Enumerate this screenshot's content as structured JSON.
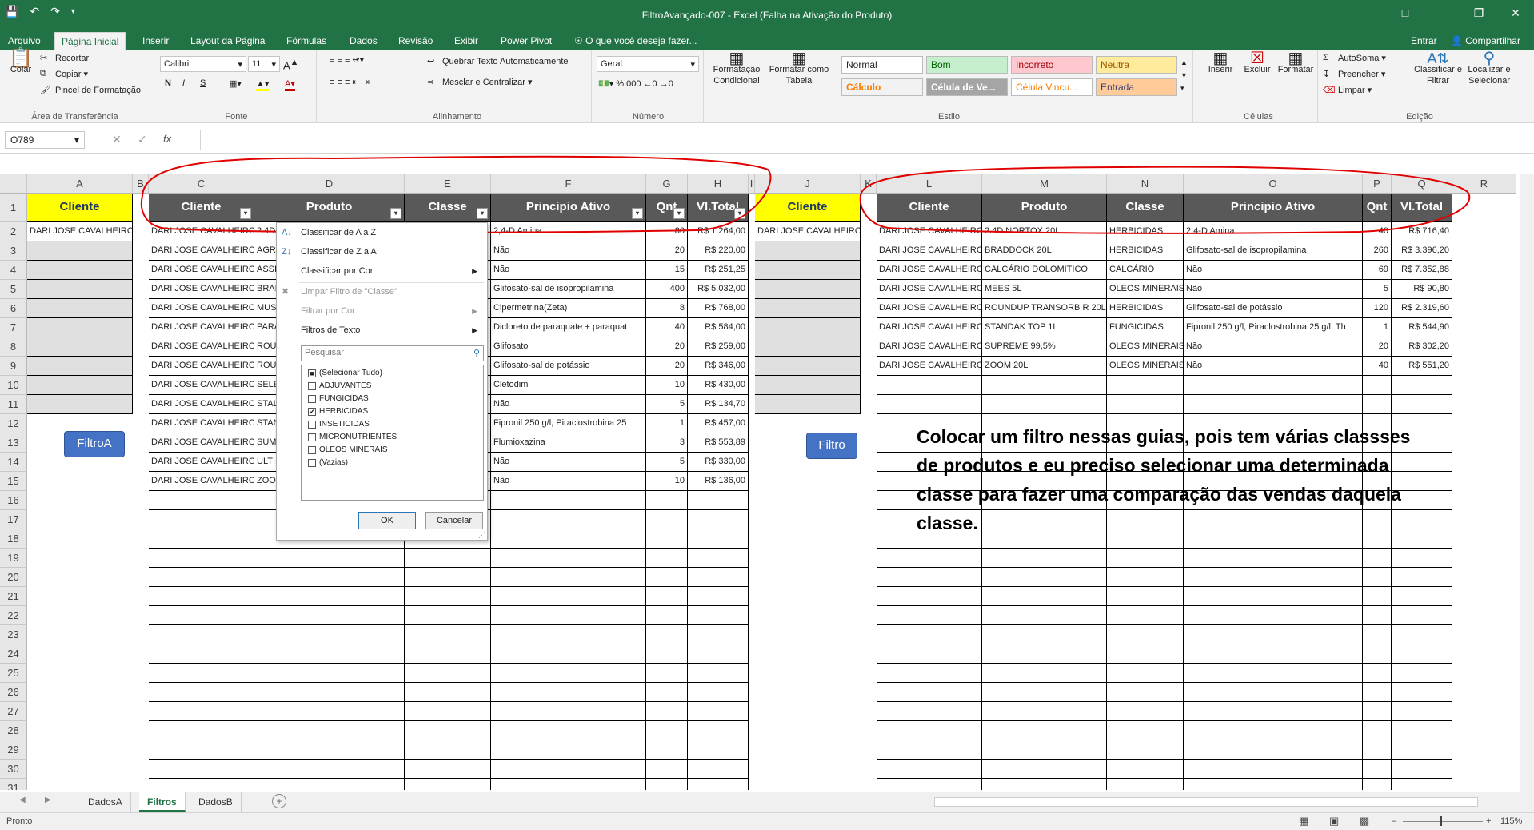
{
  "window": {
    "title": "FiltroAvançado-007 - Excel (Falha na Ativação do Produto)"
  },
  "ribbon_tabs": [
    "Arquivo",
    "Página Inicial",
    "Inserir",
    "Layout da Página",
    "Fórmulas",
    "Dados",
    "Revisão",
    "Exibir",
    "Power Pivot",
    "O que você deseja fazer..."
  ],
  "account": {
    "login": "Entrar",
    "share": "Compartilhar"
  },
  "clipboard": {
    "paste": "Colar",
    "cut": "Recortar",
    "copy": "Copiar",
    "format_painter": "Pincel de Formatação",
    "label": "Área de Transferência"
  },
  "font": {
    "name": "Calibri",
    "size": "11",
    "label": "Fonte",
    "bold": "N",
    "italic": "I",
    "underline": "S"
  },
  "alignment": {
    "wrap": "Quebrar Texto Automaticamente",
    "merge": "Mesclar e Centralizar",
    "label": "Alinhamento"
  },
  "number": {
    "format": "Geral",
    "label": "Número",
    "percent": "%",
    "thousands": "000"
  },
  "styles": {
    "cond_format": "Formatação Condicional",
    "format_table": "Formatar como Tabela",
    "label": "Estilo",
    "items": [
      "Normal",
      "Bom",
      "Incorreto",
      "Neutra",
      "Cálculo",
      "Célula de Ve...",
      "Célula Vincu...",
      "Entrada"
    ]
  },
  "cells_group": {
    "insert": "Inserir",
    "delete": "Excluir",
    "format": "Formatar",
    "label": "Células"
  },
  "editing": {
    "autosum": "AutoSoma",
    "fill": "Preencher",
    "clear": "Limpar",
    "sort_filter": "Classificar e Filtrar",
    "find": "Localizar e Selecionar",
    "label": "Edição"
  },
  "formula_bar": {
    "namebox": "O789",
    "fx": "fx",
    "value": ""
  },
  "columns": [
    "A",
    "B",
    "C",
    "D",
    "E",
    "F",
    "G",
    "H",
    "I",
    "J",
    "K",
    "L",
    "M",
    "N",
    "O",
    "P",
    "Q",
    "R"
  ],
  "rows": [
    "1",
    "2",
    "3",
    "4",
    "5",
    "6",
    "7",
    "8",
    "9",
    "10",
    "11",
    "12",
    "13",
    "14",
    "15",
    "16",
    "17",
    "18",
    "19",
    "20",
    "21",
    "22",
    "23",
    "24",
    "25",
    "26",
    "27",
    "28",
    "29",
    "30",
    "31"
  ],
  "left": {
    "a_header": "Cliente",
    "a2": "DARI JOSE CAVALHEIRO",
    "headers": [
      "Cliente",
      "Produto",
      "Classe",
      "Principio Ativo",
      "Qnt",
      "Vl.Total"
    ],
    "rows": [
      [
        "DARI JOSE CAVALHEIRO",
        "2.4D",
        "",
        "2,4-D Amina",
        "80",
        "R$ 1.264,00"
      ],
      [
        "DARI JOSE CAVALHEIRO",
        "AGR",
        "",
        "Não",
        "20",
        "R$ 220,00"
      ],
      [
        "DARI JOSE CAVALHEIRO",
        "ASSI",
        "",
        "Não",
        "15",
        "R$ 251,25"
      ],
      [
        "DARI JOSE CAVALHEIRO",
        "BRAI",
        "",
        "Glifosato-sal de isopropilamina",
        "400",
        "R$ 5.032,00"
      ],
      [
        "DARI JOSE CAVALHEIRO",
        "MUS",
        "",
        "Cipermetrina(Zeta)",
        "8",
        "R$ 768,00"
      ],
      [
        "DARI JOSE CAVALHEIRO",
        "PARA",
        "",
        "Dicloreto de paraquate + paraquat",
        "40",
        "R$ 584,00"
      ],
      [
        "DARI JOSE CAVALHEIRO",
        "ROU",
        "",
        "Glifosato",
        "20",
        "R$ 259,00"
      ],
      [
        "DARI JOSE CAVALHEIRO",
        "ROU",
        "",
        "Glifosato-sal de potássio",
        "20",
        "R$ 346,00"
      ],
      [
        "DARI JOSE CAVALHEIRO",
        "SELE",
        "",
        "Cletodim",
        "10",
        "R$ 430,00"
      ],
      [
        "DARI JOSE CAVALHEIRO",
        "STAL",
        "",
        "Não",
        "5",
        "R$ 134,70"
      ],
      [
        "DARI JOSE CAVALHEIRO",
        "STAN",
        "",
        "Fipronil 250 g/l, Piraclostrobina 25",
        "1",
        "R$ 457,00"
      ],
      [
        "DARI JOSE CAVALHEIRO",
        "SUM",
        "",
        "Flumioxazina",
        "3",
        "R$ 553,89"
      ],
      [
        "DARI JOSE CAVALHEIRO",
        "ULTI",
        "",
        "Não",
        "5",
        "R$ 330,00"
      ],
      [
        "DARI JOSE CAVALHEIRO",
        "ZOO",
        "",
        "Não",
        "10",
        "R$ 136,00"
      ]
    ],
    "button": "FiltroA"
  },
  "right": {
    "j_header": "Cliente",
    "j2": "DARI JOSE CAVALHEIRO",
    "headers": [
      "Cliente",
      "Produto",
      "Classe",
      "Principio Ativo",
      "Qnt",
      "Vl.Total"
    ],
    "rows": [
      [
        "DARI JOSE CAVALHEIRO",
        "2.4D NORTOX 20L",
        "HERBICIDAS",
        "2,4-D Amina",
        "40",
        "R$ 716,40"
      ],
      [
        "DARI JOSE CAVALHEIRO",
        "BRADDOCK 20L",
        "HERBICIDAS",
        "Glifosato-sal de isopropilamina",
        "260",
        "R$ 3.396,20"
      ],
      [
        "DARI JOSE CAVALHEIRO",
        "CALCÁRIO DOLOMITICO",
        "CALCÁRIO",
        "Não",
        "69",
        "R$ 7.352,88"
      ],
      [
        "DARI JOSE CAVALHEIRO",
        "MEES 5L",
        "OLEOS MINERAIS",
        "Não",
        "5",
        "R$ 90,80"
      ],
      [
        "DARI JOSE CAVALHEIRO",
        "ROUNDUP TRANSORB R 20L",
        "HERBICIDAS",
        "Glifosato-sal de potássio",
        "120",
        "R$ 2.319,60"
      ],
      [
        "DARI JOSE CAVALHEIRO",
        "STANDAK TOP 1L",
        "FUNGICIDAS",
        "Fipronil 250 g/l, Piraclostrobina 25 g/l, Th",
        "1",
        "R$ 544,90"
      ],
      [
        "DARI JOSE CAVALHEIRO",
        "SUPREME 99,5%",
        "OLEOS MINERAIS",
        "Não",
        "20",
        "R$ 302,20"
      ],
      [
        "DARI JOSE CAVALHEIRO",
        "ZOOM 20L",
        "OLEOS MINERAIS",
        "Não",
        "40",
        "R$ 551,20"
      ]
    ],
    "button": "Filtro"
  },
  "filter_menu": {
    "items": [
      "Classificar de A a Z",
      "Classificar de Z a A",
      "Classificar por Cor",
      "Limpar Filtro de \"Classe\"",
      "Filtrar por Cor",
      "Filtros de Texto"
    ],
    "search": "Pesquisar",
    "options": [
      {
        "label": "(Selecionar Tudo)",
        "state": "partial"
      },
      {
        "label": "ADJUVANTES",
        "state": "off"
      },
      {
        "label": "FUNGICIDAS",
        "state": "off"
      },
      {
        "label": "HERBICIDAS",
        "state": "on"
      },
      {
        "label": "INSETICIDAS",
        "state": "off"
      },
      {
        "label": "MICRONUTRIENTES",
        "state": "off"
      },
      {
        "label": "OLEOS MINERAIS",
        "state": "off"
      },
      {
        "label": "(Vazias)",
        "state": "off"
      }
    ],
    "ok": "OK",
    "cancel": "Cancelar"
  },
  "note": "Colocar um filtro nessas guias, pois tem várias classses de produtos e eu preciso selecionar uma determinada classe para fazer uma comparação das vendas daquela classe.",
  "sheets": [
    "DadosA",
    "Filtros",
    "DadosB"
  ],
  "active_sheet": "Filtros",
  "status": {
    "ready": "Pronto",
    "zoom": "115%"
  },
  "colors": {
    "excel_green": "#217346",
    "header_gray": "#595959",
    "cliente_yellow": "#ffff00",
    "button_blue": "#4472c4",
    "annotation_red": "#e00000"
  }
}
